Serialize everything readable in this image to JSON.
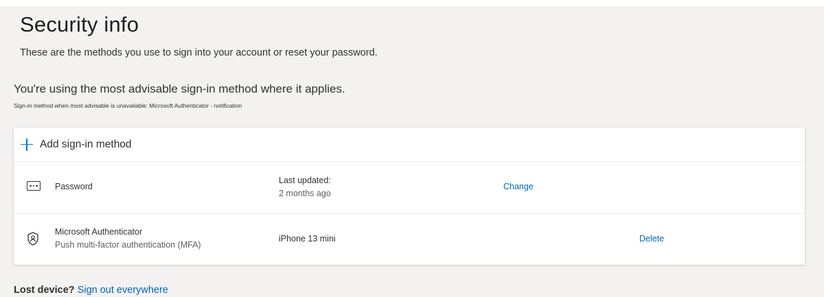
{
  "page": {
    "title": "Security info",
    "subtitle": "These are the methods you use to sign into your account or reset your password.",
    "advisable_status": "You're using the most advisable sign-in method where it applies.",
    "fallback_note": "Sign-in method when most advisable is unavailable: Microsoft Authenticator - notification"
  },
  "add_method": {
    "icon": "plus-icon",
    "label": "Add sign-in method"
  },
  "methods": [
    {
      "icon": "password-icon",
      "name": "Password",
      "subtitle": "",
      "detail_label": "Last updated:",
      "detail_value": "2 months ago",
      "action": "Change"
    },
    {
      "icon": "authenticator-icon",
      "name": "Microsoft Authenticator",
      "subtitle": "Push multi-factor authentication (MFA)",
      "detail_label": "iPhone 13 mini",
      "detail_value": "",
      "action": "Delete"
    }
  ],
  "footer": {
    "lost_label": "Lost device?",
    "sign_out_link": "Sign out everywhere"
  },
  "colors": {
    "accent": "#0078d4",
    "link": "#0067b8",
    "page_background": "#f3f2f1",
    "card_background": "#ffffff",
    "text": "#323130"
  }
}
